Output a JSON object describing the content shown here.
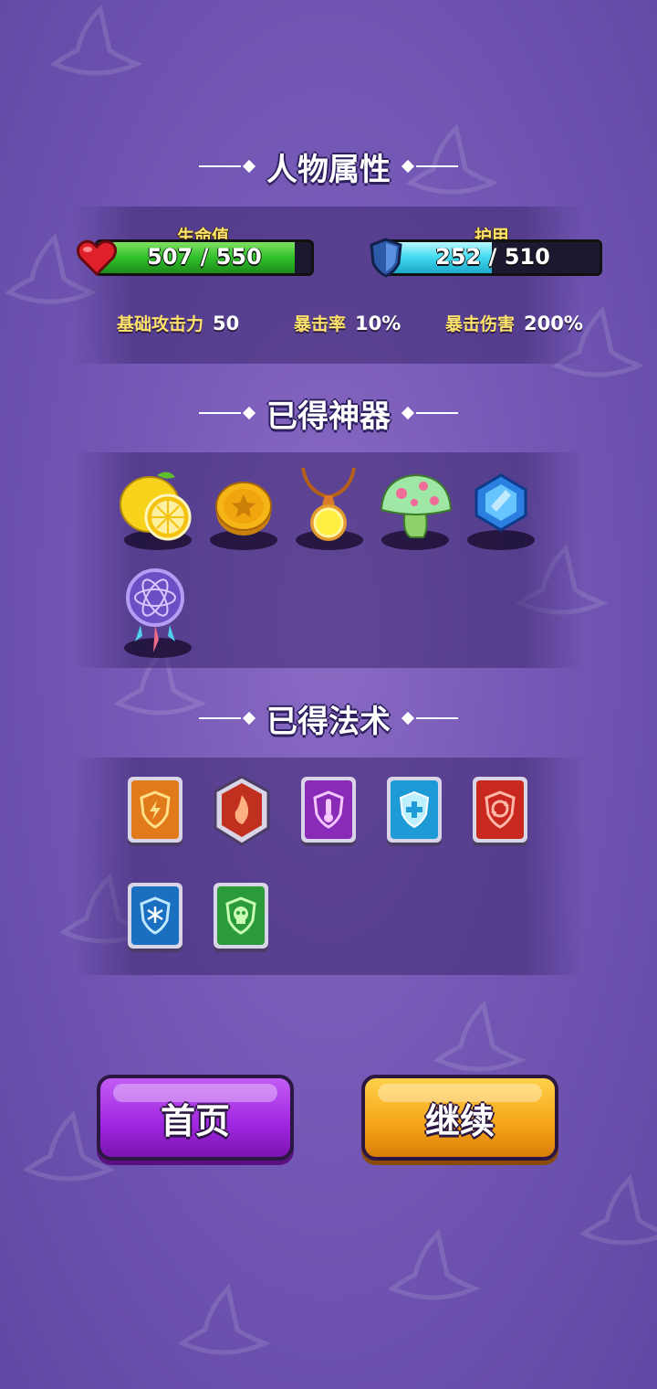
{
  "sections": {
    "attributes_title": "人物属性",
    "artifacts_title": "已得神器",
    "spells_title": "已得法术"
  },
  "hp": {
    "label": "生命值",
    "text": "507 / 550",
    "current": 507,
    "max": 550,
    "color": "#2fc02a"
  },
  "armor": {
    "label": "护甲",
    "text": "252 / 510",
    "current": 252,
    "max": 510,
    "color": "#3fd8f0"
  },
  "attributes": [
    {
      "label": "基础攻击力",
      "value": "50"
    },
    {
      "label": "暴击率",
      "value": "10%"
    },
    {
      "label": "暴击伤害",
      "value": "200%"
    }
  ],
  "artifacts": [
    {
      "icon": "lemon-icon"
    },
    {
      "icon": "gold-coin-icon"
    },
    {
      "icon": "pendant-icon"
    },
    {
      "icon": "mushroom-icon"
    },
    {
      "icon": "blue-gem-icon"
    },
    {
      "icon": "dreamcatcher-icon"
    }
  ],
  "spells": [
    {
      "icon": "lightning-shield-icon",
      "color": "#e07a1a"
    },
    {
      "icon": "fire-shield-icon",
      "color": "#c0301e"
    },
    {
      "icon": "thermometer-shield-icon",
      "color": "#8a2bb8"
    },
    {
      "icon": "heal-shield-icon",
      "color": "#1e9ad6"
    },
    {
      "icon": "cycle-shield-icon",
      "color": "#c8281e"
    },
    {
      "icon": "frost-shield-icon",
      "color": "#1a6fc0"
    },
    {
      "icon": "skull-shield-icon",
      "color": "#2a9a3a"
    }
  ],
  "buttons": {
    "home": "首页",
    "continue": "继续",
    "home_color": "#a025e0",
    "continue_color": "#f5a416"
  }
}
